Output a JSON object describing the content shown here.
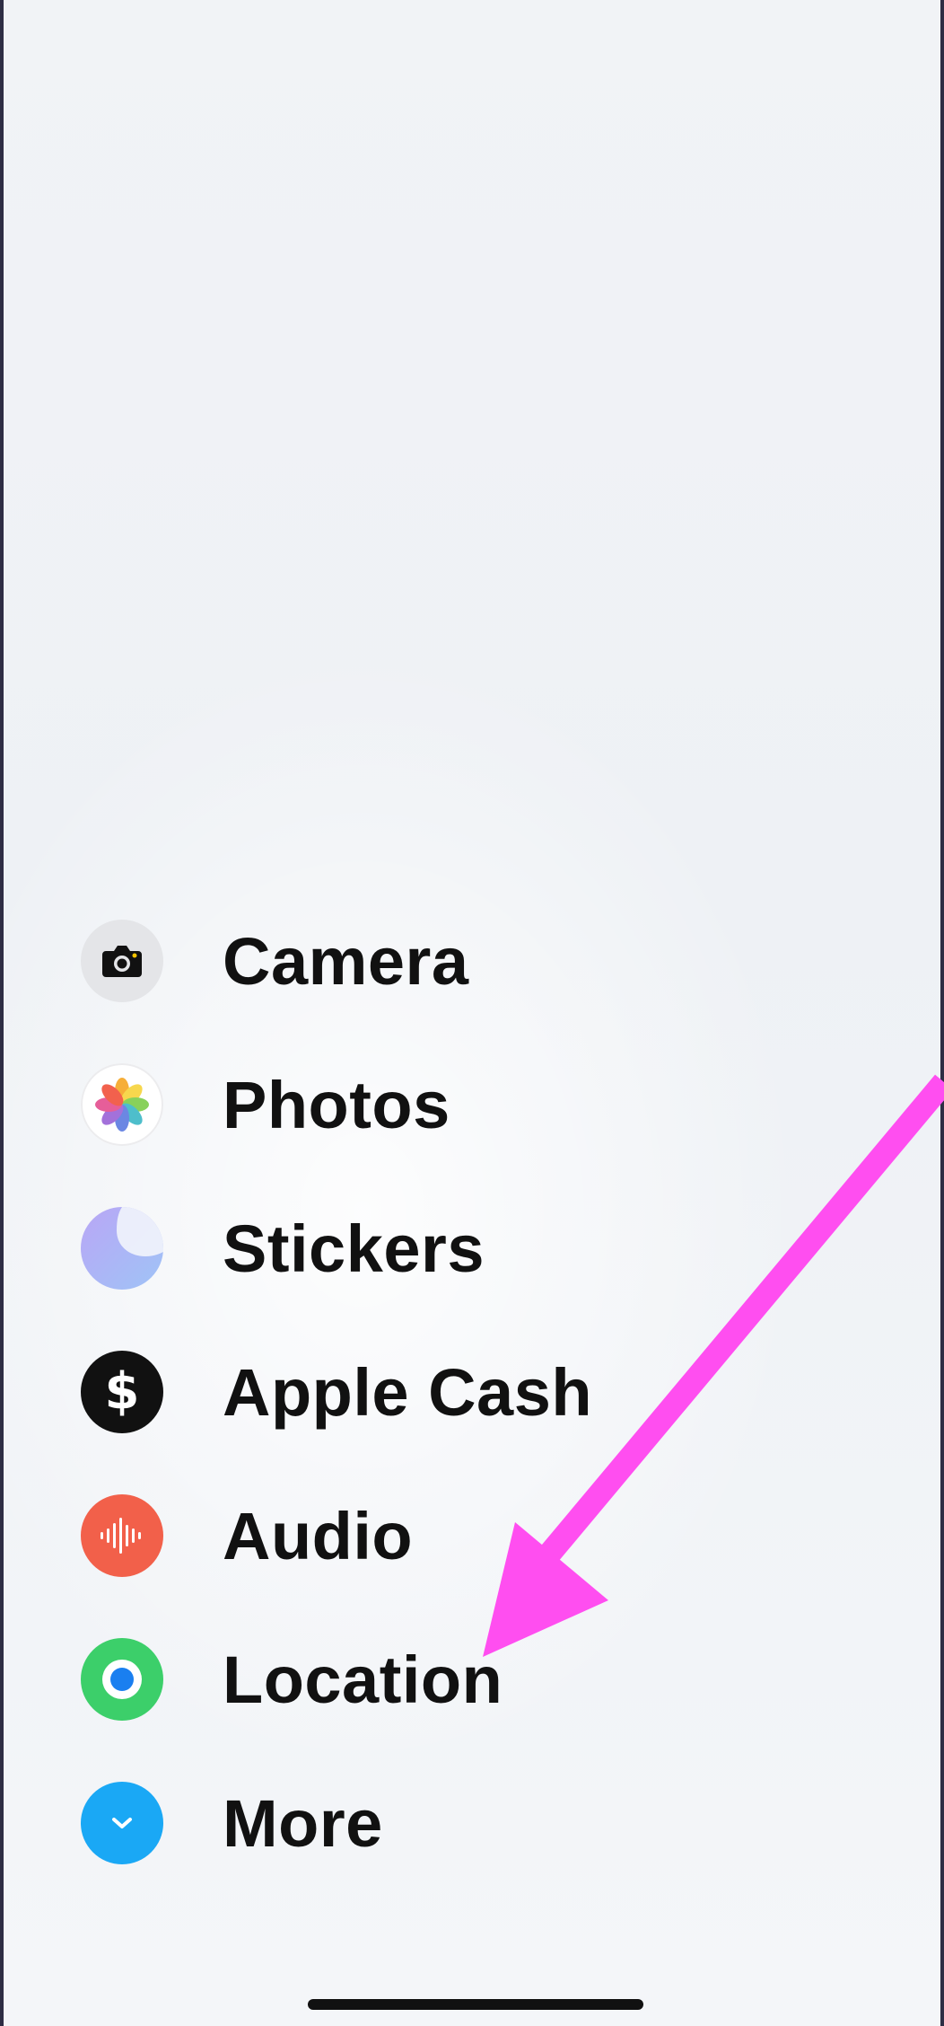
{
  "menu": {
    "items": [
      {
        "label": "Camera",
        "icon": "camera-icon"
      },
      {
        "label": "Photos",
        "icon": "photos-icon"
      },
      {
        "label": "Stickers",
        "icon": "stickers-icon"
      },
      {
        "label": "Apple Cash",
        "icon": "dollar-sign-icon"
      },
      {
        "label": "Audio",
        "icon": "waveform-icon"
      },
      {
        "label": "Location",
        "icon": "location-icon"
      },
      {
        "label": "More",
        "icon": "chevron-down-icon"
      }
    ]
  },
  "colors": {
    "annotation_arrow": "#ff4ef0",
    "audio_icon_bg": "#f2604a",
    "location_icon_bg": "#3ccf6a",
    "more_icon_bg": "#1aa8f5",
    "cash_icon_bg": "#111111"
  }
}
